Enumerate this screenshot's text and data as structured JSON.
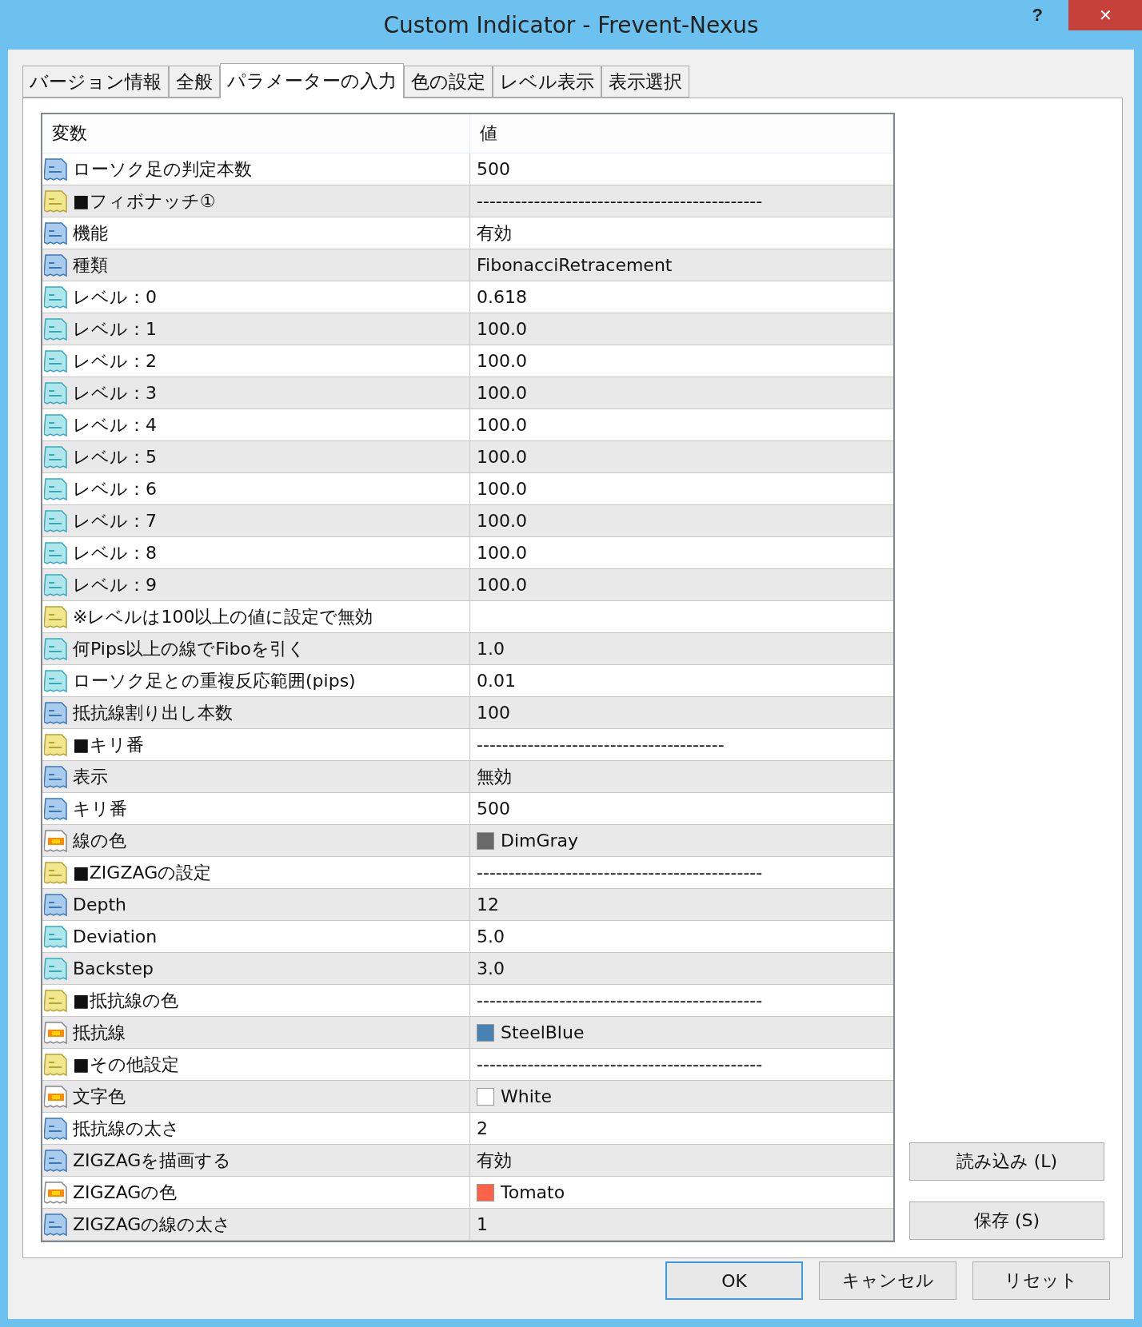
{
  "window": {
    "title": "Custom Indicator - Frevent-Nexus",
    "help": "?",
    "close": "✕"
  },
  "tabs": [
    {
      "label": "バージョン情報",
      "selected": false
    },
    {
      "label": "全般",
      "selected": false
    },
    {
      "label": "パラメーターの入力",
      "selected": true
    },
    {
      "label": "色の設定",
      "selected": false
    },
    {
      "label": "レベル表示",
      "selected": false
    },
    {
      "label": "表示選択",
      "selected": false
    }
  ],
  "table": {
    "columns": [
      "変数",
      "値"
    ],
    "rows": [
      {
        "kind": "int",
        "name": "ローソク足の判定本数",
        "value": "500"
      },
      {
        "kind": "string",
        "name": "■フィボナッチ①",
        "value": "---------------------------------------------"
      },
      {
        "kind": "int",
        "name": "機能",
        "value": "有効"
      },
      {
        "kind": "int",
        "name": "種類",
        "value": "FibonacciRetracement"
      },
      {
        "kind": "double",
        "name": "レベル：0",
        "value": "0.618"
      },
      {
        "kind": "double",
        "name": "レベル：1",
        "value": "100.0"
      },
      {
        "kind": "double",
        "name": "レベル：2",
        "value": "100.0"
      },
      {
        "kind": "double",
        "name": "レベル：3",
        "value": "100.0"
      },
      {
        "kind": "double",
        "name": "レベル：4",
        "value": "100.0"
      },
      {
        "kind": "double",
        "name": "レベル：5",
        "value": "100.0"
      },
      {
        "kind": "double",
        "name": "レベル：6",
        "value": "100.0"
      },
      {
        "kind": "double",
        "name": "レベル：7",
        "value": "100.0"
      },
      {
        "kind": "double",
        "name": "レベル：8",
        "value": "100.0"
      },
      {
        "kind": "double",
        "name": "レベル：9",
        "value": "100.0"
      },
      {
        "kind": "string",
        "name": "※レベルは100以上の値に設定で無効"
      },
      {
        "kind": "double",
        "name": "何Pips以上の線でFiboを引く",
        "value": "1.0"
      },
      {
        "kind": "double",
        "name": "ローソク足との重複反応範囲(pips)",
        "value": "0.01"
      },
      {
        "kind": "int",
        "name": "抵抗線割り出し本数",
        "value": "100"
      },
      {
        "kind": "string",
        "name": "■キリ番",
        "value": "---------------------------------------"
      },
      {
        "kind": "int",
        "name": "表示",
        "value": "無効"
      },
      {
        "kind": "int",
        "name": "キリ番",
        "value": "500"
      },
      {
        "kind": "color",
        "name": "線の色",
        "value": "DimGray",
        "color": "#696969"
      },
      {
        "kind": "string",
        "name": "■ZIGZAGの設定",
        "value": "---------------------------------------------"
      },
      {
        "kind": "int",
        "name": "Depth",
        "value": "12"
      },
      {
        "kind": "double",
        "name": "Deviation",
        "value": "5.0"
      },
      {
        "kind": "double",
        "name": "Backstep",
        "value": "3.0"
      },
      {
        "kind": "string",
        "name": "■抵抗線の色",
        "value": "---------------------------------------------"
      },
      {
        "kind": "color",
        "name": "抵抗線",
        "value": "SteelBlue",
        "color": "#4682b4"
      },
      {
        "kind": "string",
        "name": "■その他設定",
        "value": "---------------------------------------------"
      },
      {
        "kind": "color",
        "name": "文字色",
        "value": "White",
        "color": "#ffffff"
      },
      {
        "kind": "int",
        "name": "抵抗線の太さ",
        "value": "2"
      },
      {
        "kind": "int",
        "name": "ZIGZAGを描画する",
        "value": "有効"
      },
      {
        "kind": "color",
        "name": "ZIGZAGの色",
        "value": "Tomato",
        "color": "#ff6347"
      },
      {
        "kind": "int",
        "name": "ZIGZAGの線の太さ",
        "value": "1"
      }
    ]
  },
  "side_buttons": [
    "読み込み (L)",
    "保存 (S)"
  ],
  "buttons": [
    {
      "label": "OK",
      "focused": true
    },
    {
      "label": "キャンセル",
      "focused": false
    },
    {
      "label": "リセット",
      "focused": false
    }
  ]
}
